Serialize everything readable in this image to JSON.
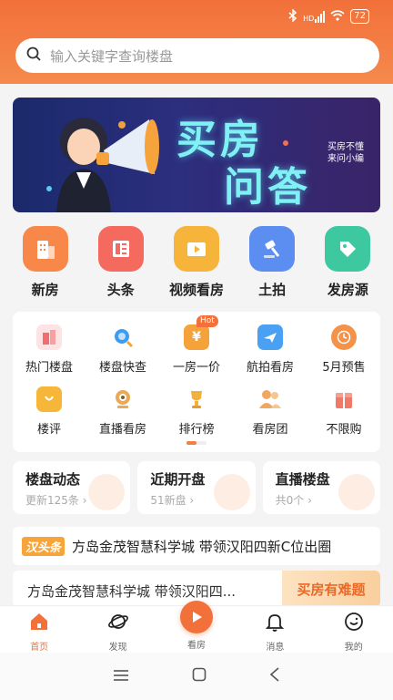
{
  "status": {
    "signal_label": "HD",
    "battery": "72"
  },
  "search": {
    "placeholder": "输入关键字查询楼盘"
  },
  "banner": {
    "title_line1": "买房",
    "title_line2": "问答",
    "tagline": "买房不懂 来问小编"
  },
  "main_icons": [
    {
      "label": "新房",
      "icon": "building-icon",
      "color": "#f7884a"
    },
    {
      "label": "头条",
      "icon": "news-icon",
      "color": "#f56a5e"
    },
    {
      "label": "视频看房",
      "icon": "video-icon",
      "color": "#f6b43a"
    },
    {
      "label": "土拍",
      "icon": "gavel-icon",
      "color": "#5b8ef0"
    },
    {
      "label": "发房源",
      "icon": "tag-icon",
      "color": "#3ec8a0"
    }
  ],
  "grid_items": [
    {
      "label": "热门楼盘",
      "icon": "buildings-icon",
      "color": "#f26e6e"
    },
    {
      "label": "楼盘快查",
      "icon": "magnifier-icon",
      "color": "#3d9cf0"
    },
    {
      "label": "一房一价",
      "icon": "price-icon",
      "color": "#f5a23a",
      "badge": "Hot"
    },
    {
      "label": "航拍看房",
      "icon": "plane-icon",
      "color": "#4aa0f2"
    },
    {
      "label": "5月预售",
      "icon": "clock-icon",
      "color": "#f5924a"
    },
    {
      "label": "楼评",
      "icon": "comment-icon",
      "color": "#f5b63a"
    },
    {
      "label": "直播看房",
      "icon": "camera-icon",
      "color": "#e9a955"
    },
    {
      "label": "排行榜",
      "icon": "trophy-icon",
      "color": "#f0b23a"
    },
    {
      "label": "看房团",
      "icon": "group-icon",
      "color": "#f0a860"
    },
    {
      "label": "不限购",
      "icon": "gift-icon",
      "color": "#f07a6a"
    }
  ],
  "cards": [
    {
      "title": "楼盘动态",
      "subtitle": "更新125条 ›"
    },
    {
      "title": "近期开盘",
      "subtitle": "51新盘 ›"
    },
    {
      "title": "直播楼盘",
      "subtitle": "共0个 ›"
    }
  ],
  "headline": {
    "badge": "汉头条",
    "text": "方岛金茂智慧科学城 带领汉阳四新C位出圈"
  },
  "headline2": {
    "text": "方岛金茂智慧科学城 带领汉阳四...",
    "ask_label": "买房有难题"
  },
  "tabs": [
    {
      "label": "首页",
      "icon": "home-icon"
    },
    {
      "label": "发现",
      "icon": "planet-icon"
    },
    {
      "label": "看房",
      "icon": "play-icon"
    },
    {
      "label": "消息",
      "icon": "bell-icon"
    },
    {
      "label": "我的",
      "icon": "smile-icon"
    }
  ],
  "colors": {
    "accent": "#f2703a"
  }
}
